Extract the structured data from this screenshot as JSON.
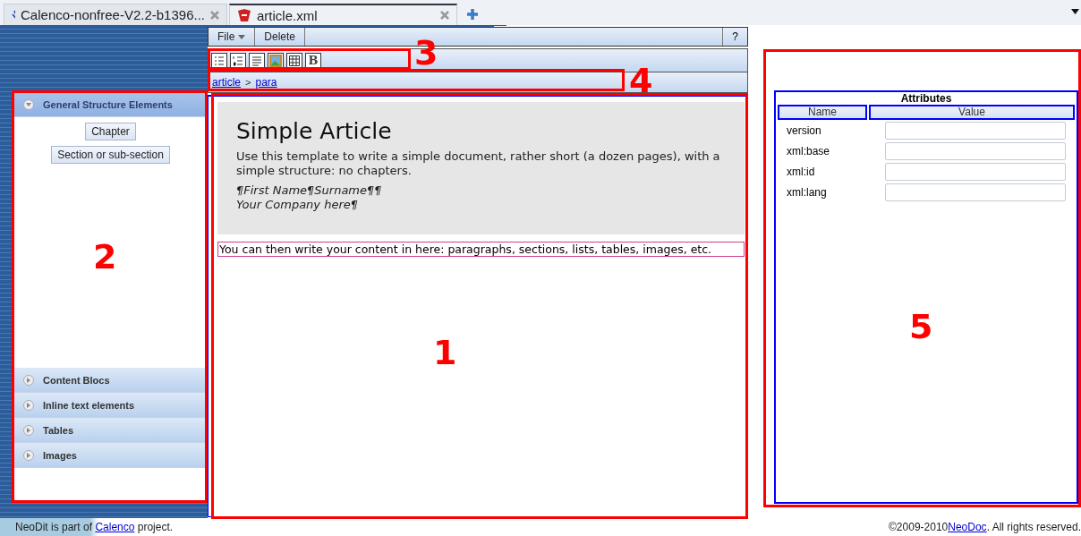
{
  "tabs": [
    {
      "label": "Calenco-nonfree-V2.2-b1396...",
      "selected": false
    },
    {
      "label": "article.xml",
      "selected": true
    }
  ],
  "menu": {
    "items": [
      {
        "label": "File",
        "dropdown": true
      },
      {
        "label": "Delete",
        "dropdown": false
      }
    ],
    "help": "?"
  },
  "toolbar": [
    {
      "kind": "bullet-list"
    },
    {
      "kind": "numbered-list"
    },
    {
      "kind": "paragraph"
    },
    {
      "kind": "image"
    },
    {
      "kind": "table"
    },
    {
      "kind": "bold",
      "label": "B"
    }
  ],
  "breadcrumb": {
    "items": [
      "article",
      "para"
    ],
    "separator": ">"
  },
  "sidebar": {
    "sections": [
      {
        "label": "General Structure Elements",
        "expanded": true,
        "items": [
          "Chapter",
          "Section or sub-section"
        ]
      },
      {
        "label": "Content Blocs",
        "expanded": false
      },
      {
        "label": "Inline text elements",
        "expanded": false
      },
      {
        "label": "Tables",
        "expanded": false
      },
      {
        "label": "Images",
        "expanded": false
      }
    ]
  },
  "document": {
    "title": "Simple Article",
    "abstract": "Use this template to write a simple document, rather short (a dozen pages), with a simple structure: no chapters.",
    "author": "¶First Name¶Surname¶¶",
    "company": "Your Company here¶",
    "paragraph": "You can then write your content in here: paragraphs, sections, lists, tables, images, etc."
  },
  "attributes": {
    "title": "Attributes",
    "columns": [
      "Name",
      "Value"
    ],
    "rows": [
      {
        "name": "version"
      },
      {
        "name": "xml:base"
      },
      {
        "name": "xml:id"
      },
      {
        "name": "xml:lang"
      }
    ]
  },
  "footer": {
    "left": {
      "before": "NeoDit is part of ",
      "link": "Calenco",
      "after": " project."
    },
    "right": {
      "before": "©2009-2010",
      "link": "NeoDoc",
      "after": ". All rights reserved."
    }
  },
  "annotations": [
    {
      "label": "3"
    },
    {
      "label": "4"
    },
    {
      "label": "2"
    },
    {
      "label": "1"
    },
    {
      "label": "5"
    }
  ]
}
